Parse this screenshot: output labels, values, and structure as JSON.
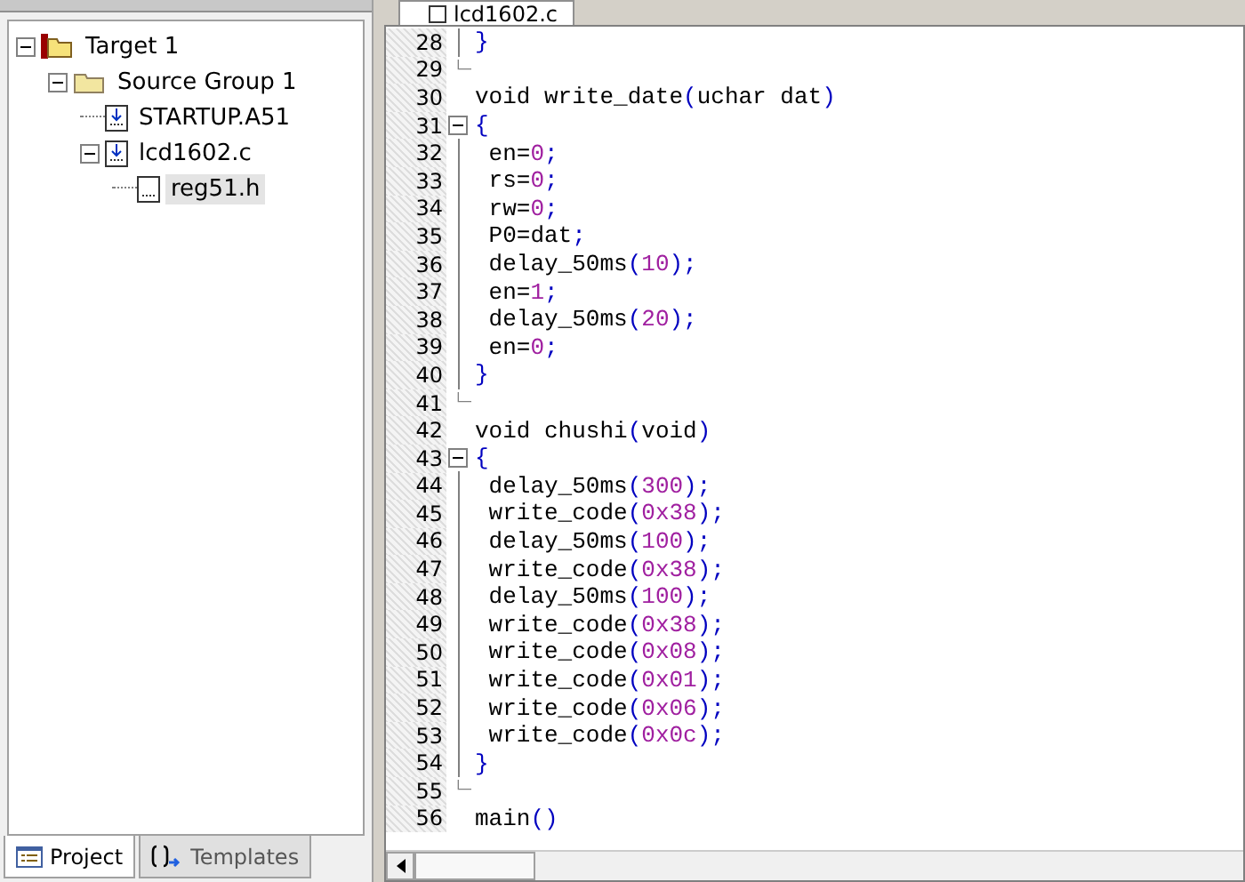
{
  "project_panel": {
    "tree": [
      {
        "label": "Target 1",
        "kind": "target",
        "expanded": true,
        "selected": false,
        "children": [
          {
            "label": "Source Group 1",
            "kind": "group",
            "expanded": true,
            "selected": false,
            "children": [
              {
                "label": "STARTUP.A51",
                "kind": "source",
                "selected": false
              },
              {
                "label": "lcd1602.c",
                "kind": "source",
                "expanded": true,
                "selected": false,
                "children": [
                  {
                    "label": "reg51.h",
                    "kind": "header",
                    "selected": true
                  }
                ]
              }
            ]
          }
        ]
      }
    ],
    "tabs": [
      {
        "label": "Project",
        "kind": "project",
        "selected": true
      },
      {
        "label": "Templates",
        "kind": "templates",
        "selected": false
      }
    ]
  },
  "editor": {
    "tab": {
      "label": "lcd1602.c"
    },
    "lines": [
      {
        "number": "28",
        "kind": "body",
        "segments": [
          {
            "kind": "punct",
            "text": "}"
          }
        ]
      },
      {
        "number": "29",
        "kind": "end"
      },
      {
        "number": "30",
        "kind": "plain",
        "segments": [
          {
            "kind": "plain",
            "text": "void write_date"
          },
          {
            "kind": "punct",
            "text": "("
          },
          {
            "kind": "plain",
            "text": "uchar dat"
          },
          {
            "kind": "punct",
            "text": ")"
          }
        ]
      },
      {
        "number": "31",
        "kind": "start",
        "segments": [
          {
            "kind": "punct",
            "text": "{"
          }
        ]
      },
      {
        "number": "32",
        "kind": "body",
        "segments": [
          {
            "kind": "plain",
            "text": " en="
          },
          {
            "kind": "num",
            "text": "0"
          },
          {
            "kind": "punct",
            "text": ";"
          }
        ]
      },
      {
        "number": "33",
        "kind": "body",
        "segments": [
          {
            "kind": "plain",
            "text": " rs="
          },
          {
            "kind": "num",
            "text": "0"
          },
          {
            "kind": "punct",
            "text": ";"
          }
        ]
      },
      {
        "number": "34",
        "kind": "body",
        "segments": [
          {
            "kind": "plain",
            "text": " rw="
          },
          {
            "kind": "num",
            "text": "0"
          },
          {
            "kind": "punct",
            "text": ";"
          }
        ]
      },
      {
        "number": "35",
        "kind": "body",
        "segments": [
          {
            "kind": "plain",
            "text": " P0=dat"
          },
          {
            "kind": "punct",
            "text": ";"
          }
        ]
      },
      {
        "number": "36",
        "kind": "body",
        "segments": [
          {
            "kind": "plain",
            "text": " delay_50ms"
          },
          {
            "kind": "punct",
            "text": "("
          },
          {
            "kind": "num",
            "text": "10"
          },
          {
            "kind": "punct",
            "text": ");"
          }
        ]
      },
      {
        "number": "37",
        "kind": "body",
        "segments": [
          {
            "kind": "plain",
            "text": " en="
          },
          {
            "kind": "num",
            "text": "1"
          },
          {
            "kind": "punct",
            "text": ";"
          }
        ]
      },
      {
        "number": "38",
        "kind": "body",
        "segments": [
          {
            "kind": "plain",
            "text": " delay_50ms"
          },
          {
            "kind": "punct",
            "text": "("
          },
          {
            "kind": "num",
            "text": "20"
          },
          {
            "kind": "punct",
            "text": ");"
          }
        ]
      },
      {
        "number": "39",
        "kind": "body",
        "segments": [
          {
            "kind": "plain",
            "text": " en="
          },
          {
            "kind": "num",
            "text": "0"
          },
          {
            "kind": "punct",
            "text": ";"
          }
        ]
      },
      {
        "number": "40",
        "kind": "body",
        "segments": [
          {
            "kind": "punct",
            "text": "}"
          }
        ]
      },
      {
        "number": "41",
        "kind": "end"
      },
      {
        "number": "42",
        "kind": "plain",
        "segments": [
          {
            "kind": "plain",
            "text": "void chushi"
          },
          {
            "kind": "punct",
            "text": "("
          },
          {
            "kind": "plain",
            "text": "void"
          },
          {
            "kind": "punct",
            "text": ")"
          }
        ]
      },
      {
        "number": "43",
        "kind": "start",
        "segments": [
          {
            "kind": "punct",
            "text": "{"
          }
        ]
      },
      {
        "number": "44",
        "kind": "body",
        "segments": [
          {
            "kind": "plain",
            "text": " delay_50ms"
          },
          {
            "kind": "punct",
            "text": "("
          },
          {
            "kind": "num",
            "text": "300"
          },
          {
            "kind": "punct",
            "text": ");"
          }
        ]
      },
      {
        "number": "45",
        "kind": "body",
        "segments": [
          {
            "kind": "plain",
            "text": " write_code"
          },
          {
            "kind": "punct",
            "text": "("
          },
          {
            "kind": "num",
            "text": "0x38"
          },
          {
            "kind": "punct",
            "text": ");"
          }
        ]
      },
      {
        "number": "46",
        "kind": "body",
        "segments": [
          {
            "kind": "plain",
            "text": " delay_50ms"
          },
          {
            "kind": "punct",
            "text": "("
          },
          {
            "kind": "num",
            "text": "100"
          },
          {
            "kind": "punct",
            "text": ");"
          }
        ]
      },
      {
        "number": "47",
        "kind": "body",
        "segments": [
          {
            "kind": "plain",
            "text": " write_code"
          },
          {
            "kind": "punct",
            "text": "("
          },
          {
            "kind": "num",
            "text": "0x38"
          },
          {
            "kind": "punct",
            "text": ");"
          }
        ]
      },
      {
        "number": "48",
        "kind": "body",
        "segments": [
          {
            "kind": "plain",
            "text": " delay_50ms"
          },
          {
            "kind": "punct",
            "text": "("
          },
          {
            "kind": "num",
            "text": "100"
          },
          {
            "kind": "punct",
            "text": ");"
          }
        ]
      },
      {
        "number": "49",
        "kind": "body",
        "segments": [
          {
            "kind": "plain",
            "text": " write_code"
          },
          {
            "kind": "punct",
            "text": "("
          },
          {
            "kind": "num",
            "text": "0x38"
          },
          {
            "kind": "punct",
            "text": ");"
          }
        ]
      },
      {
        "number": "50",
        "kind": "body",
        "segments": [
          {
            "kind": "plain",
            "text": " write_code"
          },
          {
            "kind": "punct",
            "text": "("
          },
          {
            "kind": "num",
            "text": "0x08"
          },
          {
            "kind": "punct",
            "text": ");"
          }
        ]
      },
      {
        "number": "51",
        "kind": "body",
        "segments": [
          {
            "kind": "plain",
            "text": " write_code"
          },
          {
            "kind": "punct",
            "text": "("
          },
          {
            "kind": "num",
            "text": "0x01"
          },
          {
            "kind": "punct",
            "text": ");"
          }
        ]
      },
      {
        "number": "52",
        "kind": "body",
        "segments": [
          {
            "kind": "plain",
            "text": " write_code"
          },
          {
            "kind": "punct",
            "text": "("
          },
          {
            "kind": "num",
            "text": "0x06"
          },
          {
            "kind": "punct",
            "text": ");"
          }
        ]
      },
      {
        "number": "53",
        "kind": "body",
        "segments": [
          {
            "kind": "plain",
            "text": " write_code"
          },
          {
            "kind": "punct",
            "text": "("
          },
          {
            "kind": "num",
            "text": "0x0c"
          },
          {
            "kind": "punct",
            "text": ");"
          }
        ]
      },
      {
        "number": "54",
        "kind": "body",
        "segments": [
          {
            "kind": "punct",
            "text": "}"
          }
        ]
      },
      {
        "number": "55",
        "kind": "end"
      },
      {
        "number": "56",
        "kind": "plain",
        "segments": [
          {
            "kind": "plain",
            "text": "main"
          },
          {
            "kind": "punct",
            "text": "()"
          }
        ]
      }
    ]
  }
}
